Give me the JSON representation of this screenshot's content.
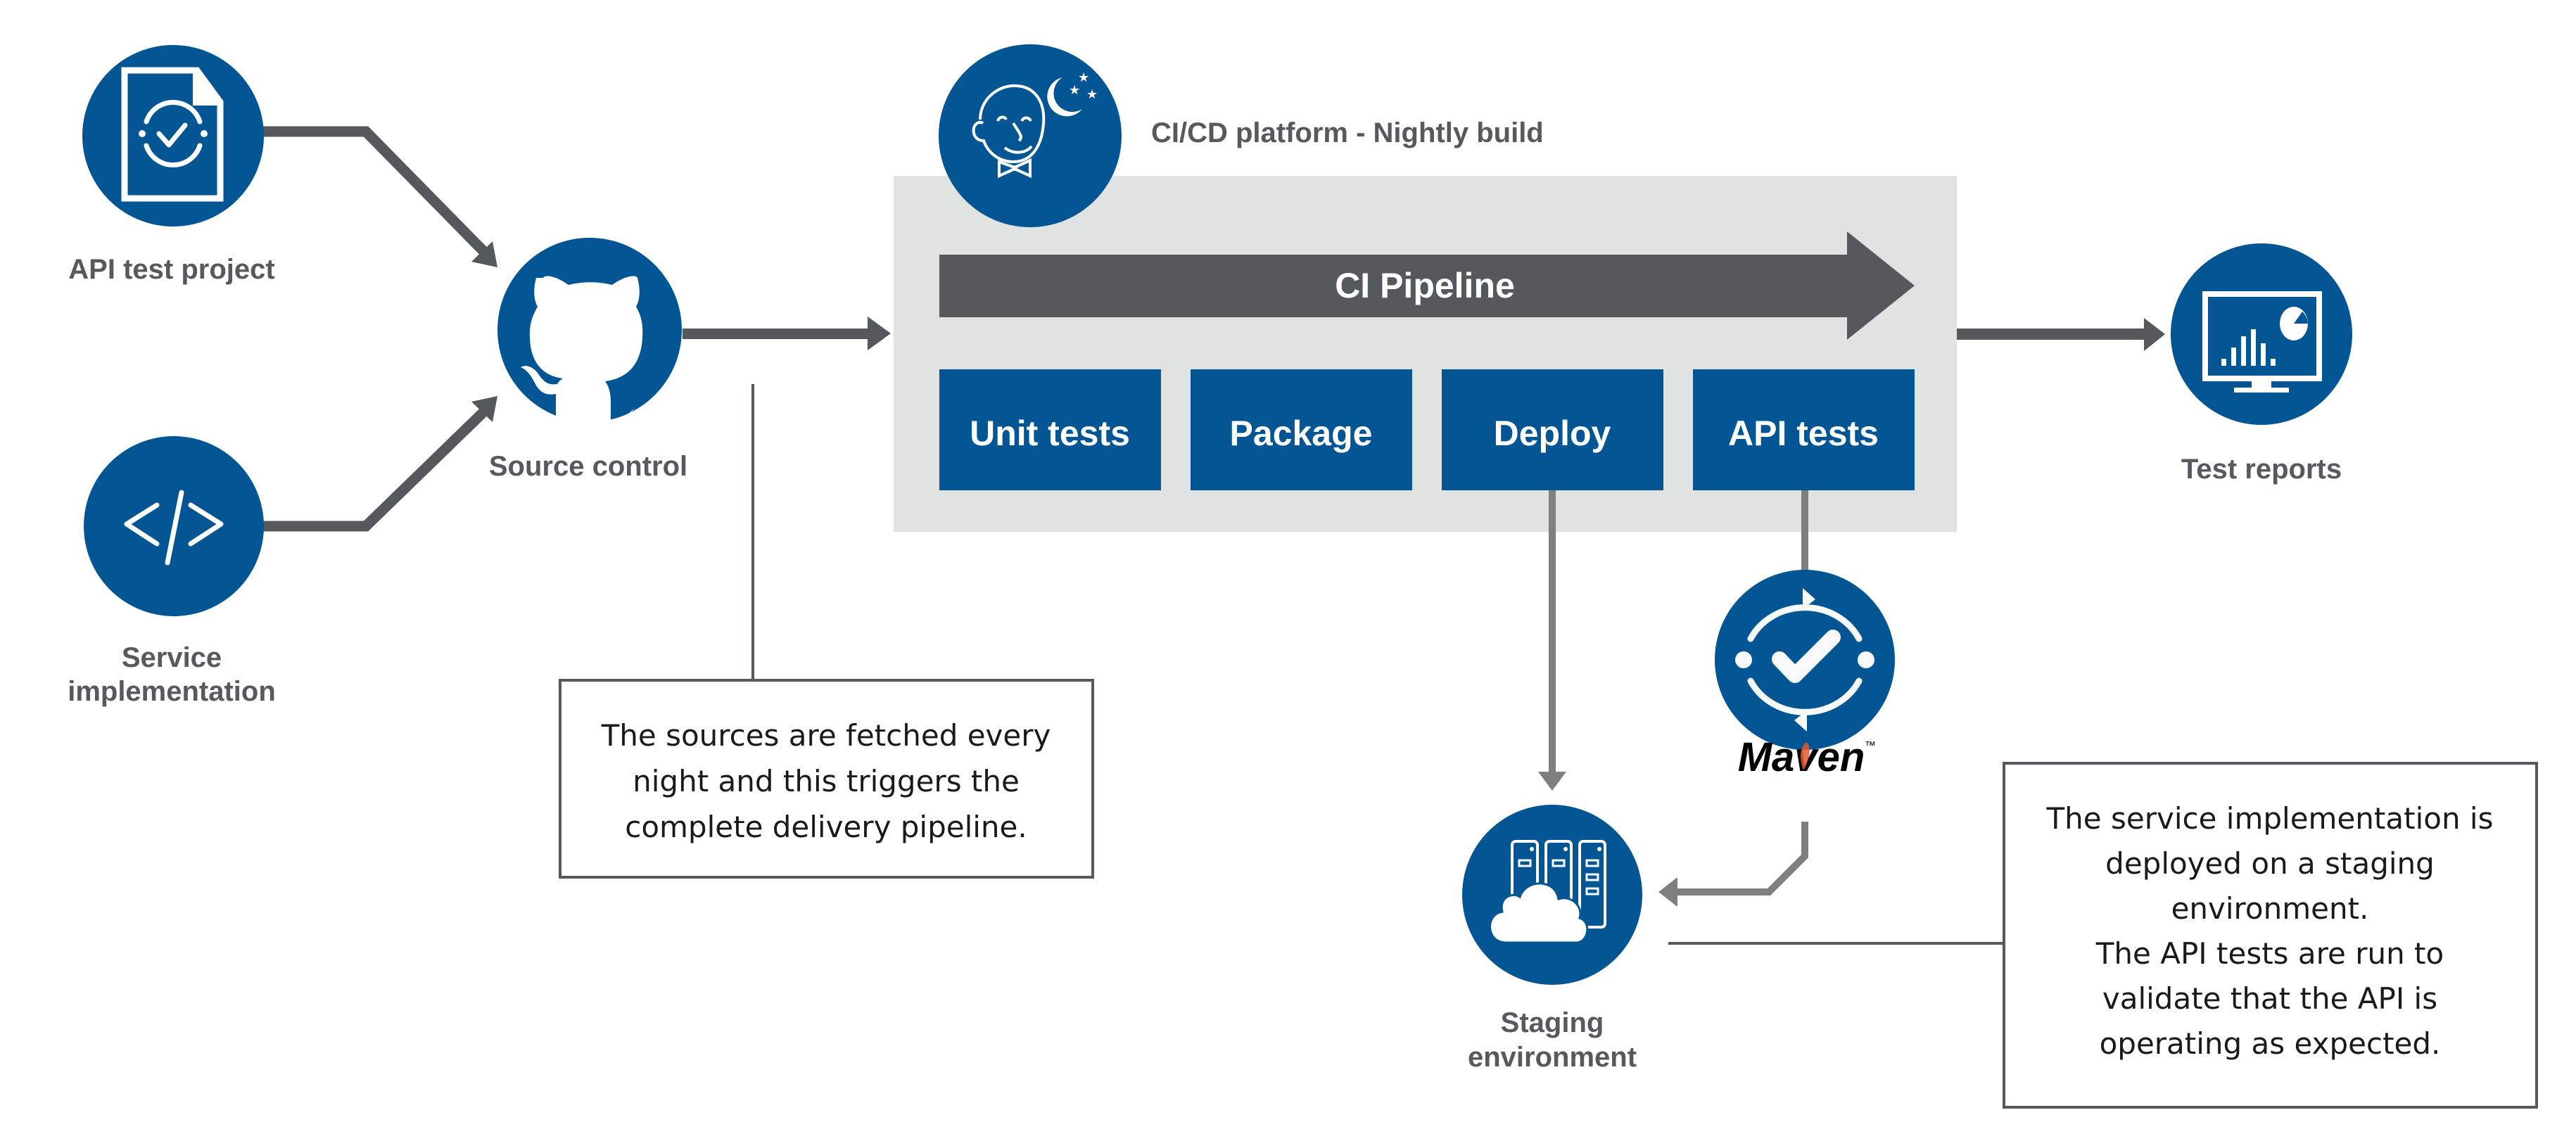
{
  "colors": {
    "brand_blue": "#035693",
    "arrow_dark": "#55585d",
    "connector_gray": "#7f7f7f",
    "panel_gray": "#e1e3e3",
    "label_gray": "#58595d"
  },
  "nodes": {
    "api_test_project": {
      "label": "API test project",
      "icon": "test-document-icon"
    },
    "service_implementation": {
      "label_line1": "Service",
      "label_line2": "implementation",
      "icon": "code-icon"
    },
    "source_control": {
      "label": "Source control",
      "icon": "github-icon"
    },
    "ci_platform": {
      "label": "CI/CD platform - Nightly build",
      "icon": "jenkins-icon"
    },
    "test_reports": {
      "label": "Test reports",
      "icon": "monitor-chart-icon"
    },
    "maven": {
      "label": "Maven",
      "trademark": "™",
      "icon": "test-cycle-icon"
    },
    "staging": {
      "label_line1": "Staging",
      "label_line2": "environment",
      "icon": "cloud-server-icon"
    }
  },
  "pipeline": {
    "title": "CI Pipeline",
    "stages": [
      {
        "label": "Unit tests"
      },
      {
        "label": "Package"
      },
      {
        "label": "Deploy"
      },
      {
        "label": "API tests"
      }
    ]
  },
  "notes": {
    "sources": {
      "lines": [
        "The sources are fetched every",
        "night and this triggers the",
        "complete delivery pipeline."
      ]
    },
    "staging": {
      "lines": [
        "The service implementation is",
        "deployed on a staging",
        "environment.",
        "The API tests are run to",
        "validate that the API is",
        "operating as expected."
      ]
    }
  }
}
